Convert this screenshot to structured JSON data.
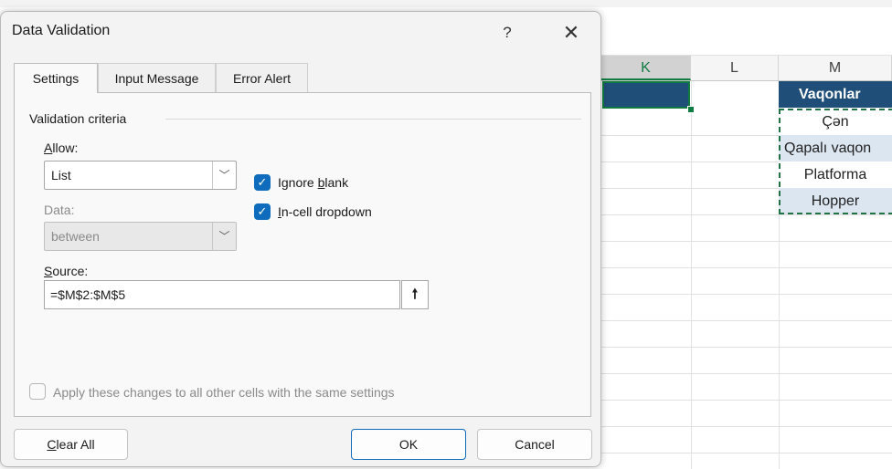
{
  "dialog": {
    "title": "Data Validation",
    "help": "?",
    "close": "✕",
    "tabs": [
      {
        "label": "Settings",
        "active": true
      },
      {
        "label": "Input Message",
        "active": false
      },
      {
        "label": "Error Alert",
        "active": false
      }
    ],
    "settings": {
      "criteria_heading": "Validation criteria",
      "allow_label_prefix": "A",
      "allow_label_rest": "llow:",
      "allow_value": "List",
      "data_label": "Data:",
      "data_value": "between",
      "ignore_blank_pre": "Ignore ",
      "ignore_blank_key": "b",
      "ignore_blank_post": "lank",
      "ignore_blank_checked": true,
      "in_cell_key": "I",
      "in_cell_post": "n-cell dropdown",
      "in_cell_checked": true,
      "source_label_key": "S",
      "source_label_rest": "ource:",
      "source_value": "=$M$2:$M$5",
      "collapse_icon": "🠕",
      "apply_all_label": "Apply these changes to all other cells with the same settings",
      "apply_all_checked": false
    },
    "buttons": {
      "clear_all_key": "C",
      "clear_all_rest": "lear All",
      "ok": "OK",
      "cancel": "Cancel"
    }
  },
  "sheet": {
    "columns": [
      "K",
      "L",
      "M"
    ],
    "column_m": {
      "header": "Vaqonlar",
      "values": [
        "Çən",
        "Qapalı vaqon",
        "Platforma",
        "Hopper"
      ]
    },
    "colors": {
      "header_fill": "#1f4e79",
      "band_fill": "#dce6f1",
      "selection": "#107c41",
      "checkbox_accent": "#0f6cbd"
    }
  }
}
